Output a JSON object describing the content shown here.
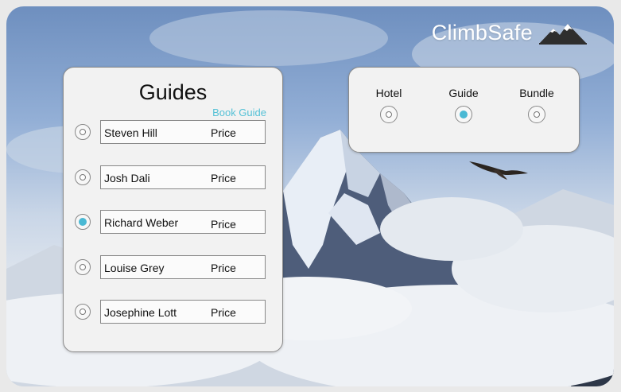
{
  "brand": {
    "name": "ClimbSafe",
    "logo_icon": "mountain-logo-icon"
  },
  "guides_panel": {
    "title": "Guides",
    "book_link": "Book Guide",
    "guides": [
      {
        "name": "Steven Hill",
        "price": "Price",
        "selected": false
      },
      {
        "name": "Josh Dali",
        "price": "Price",
        "selected": false
      },
      {
        "name": "Richard Weber",
        "price": "Price",
        "selected": true
      },
      {
        "name": "Louise Grey",
        "price": "Price",
        "selected": false
      },
      {
        "name": "Josephine Lott",
        "price": "Price",
        "selected": false
      }
    ]
  },
  "type_panel": {
    "options": [
      {
        "label": "Hotel",
        "selected": false
      },
      {
        "label": "Guide",
        "selected": true
      },
      {
        "label": "Bundle",
        "selected": false
      }
    ]
  },
  "colors": {
    "accent": "#4ab9d4",
    "link": "#55c1d6",
    "panel": "#f2f2f2"
  }
}
